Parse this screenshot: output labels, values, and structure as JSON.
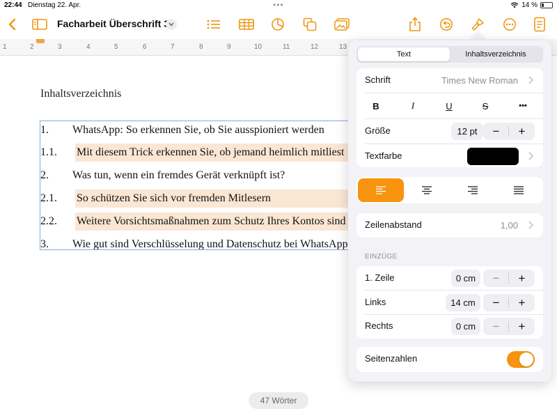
{
  "status": {
    "time": "22:44",
    "date": "Dienstag 22. Apr.",
    "battery": "14 %"
  },
  "toolbar": {
    "title": "Facharbeit Überschrift 3"
  },
  "ruler": {
    "numbers": [
      "1",
      "2",
      "3",
      "4",
      "5",
      "6",
      "7",
      "8",
      "9",
      "10",
      "11",
      "12",
      "13"
    ]
  },
  "document": {
    "heading": "Inhaltsverzeichnis",
    "toc": [
      {
        "num": "1.",
        "text": "WhatsApp: So erkennen Sie, ob Sie ausspioniert werden"
      },
      {
        "num": "1.1.",
        "text": "Mit diesem Trick erkennen Sie, ob jemand heimlich mitliest"
      },
      {
        "num": "2.",
        "text": "Was tun, wenn ein fremdes Gerät verknüpft ist?"
      },
      {
        "num": "2.1.",
        "text": "So schützen Sie sich vor fremden Mitlesern"
      },
      {
        "num": "2.2.",
        "text": "Weitere Vorsichtsmaßnahmen zum Schutz Ihres Kontos sind ..."
      },
      {
        "num": "3.",
        "text": "Wie gut sind Verschlüsselung und Datenschutz bei WhatsApp?"
      }
    ]
  },
  "word_count": "47 Wörter",
  "panel": {
    "tabs": [
      "Text",
      "Inhaltsverzeichnis"
    ],
    "font": {
      "label": "Schrift",
      "value": "Times New Roman"
    },
    "styles": {
      "bold": "B",
      "italic": "I",
      "underline": "U",
      "strike": "S",
      "more": "•••"
    },
    "size": {
      "label": "Größe",
      "value": "12 pt"
    },
    "color": {
      "label": "Textfarbe",
      "swatch": "#000000"
    },
    "line_spacing": {
      "label": "Zeilenabstand",
      "value": "1,00"
    },
    "indents": {
      "section": "EINZÜGE",
      "first_line": {
        "label": "1. Zeile",
        "value": "0 cm"
      },
      "left": {
        "label": "Links",
        "value": "14 cm"
      },
      "right": {
        "label": "Rechts",
        "value": "0 cm"
      }
    },
    "page_numbers": {
      "label": "Seitenzahlen",
      "on": true
    }
  },
  "colors": {
    "accent": "#f7930e",
    "highlight": "#fbe6d4"
  }
}
